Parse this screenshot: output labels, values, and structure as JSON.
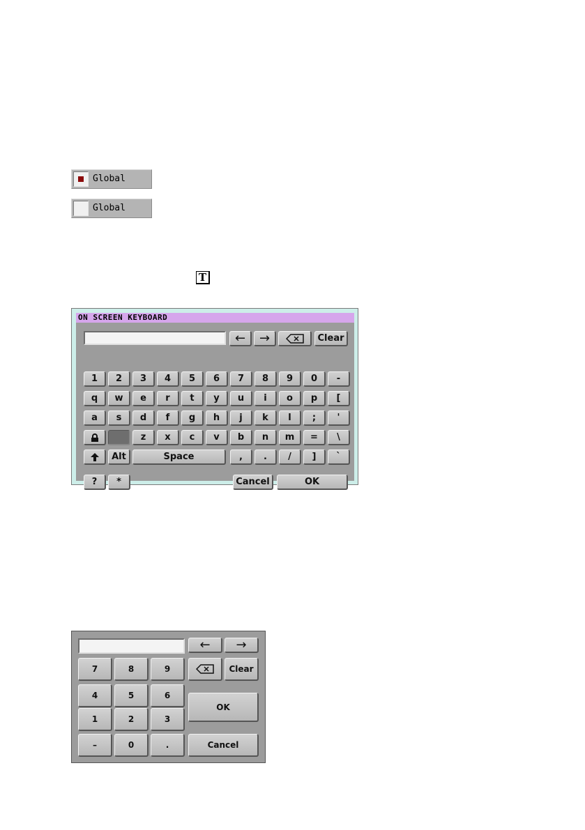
{
  "checkboxes": [
    {
      "label": "Global",
      "checked": true
    },
    {
      "label": "Global",
      "checked": false
    }
  ],
  "text_icon": {
    "glyph": "T"
  },
  "keyboard": {
    "title": "ON SCREEN KEYBOARD",
    "input_value": "",
    "left_arrow": "←",
    "right_arrow": "→",
    "clear": "Clear",
    "row1": [
      "1",
      "2",
      "3",
      "4",
      "5",
      "6",
      "7",
      "8",
      "9",
      "0",
      "-"
    ],
    "row2": [
      "q",
      "w",
      "e",
      "r",
      "t",
      "y",
      "u",
      "i",
      "o",
      "p",
      "["
    ],
    "row3": [
      "a",
      "s",
      "d",
      "f",
      "g",
      "h",
      "j",
      "k",
      "l",
      ";",
      "'"
    ],
    "row4": [
      "z",
      "x",
      "c",
      "v",
      "b",
      "n",
      "m",
      "=",
      "\\"
    ],
    "row5_alt": "Alt",
    "space": "Space",
    "row5": [
      ",",
      ".",
      "/",
      "]",
      "`"
    ],
    "help": "?",
    "star": "*",
    "cancel": "Cancel",
    "ok": "OK"
  },
  "numpad": {
    "input_value": "",
    "left_arrow": "←",
    "right_arrow": "→",
    "clear": "Clear",
    "row1": [
      "7",
      "8",
      "9"
    ],
    "row2": [
      "4",
      "5",
      "6"
    ],
    "row3": [
      "1",
      "2",
      "3"
    ],
    "row4": [
      "–",
      "0",
      "."
    ],
    "ok": "OK",
    "cancel": "Cancel"
  },
  "colors": {
    "checkbox_mark": "#8b0a0a",
    "title_bar": "#d6a6ec",
    "frame": "#cdeee9",
    "panel": "#9c9c9c"
  }
}
